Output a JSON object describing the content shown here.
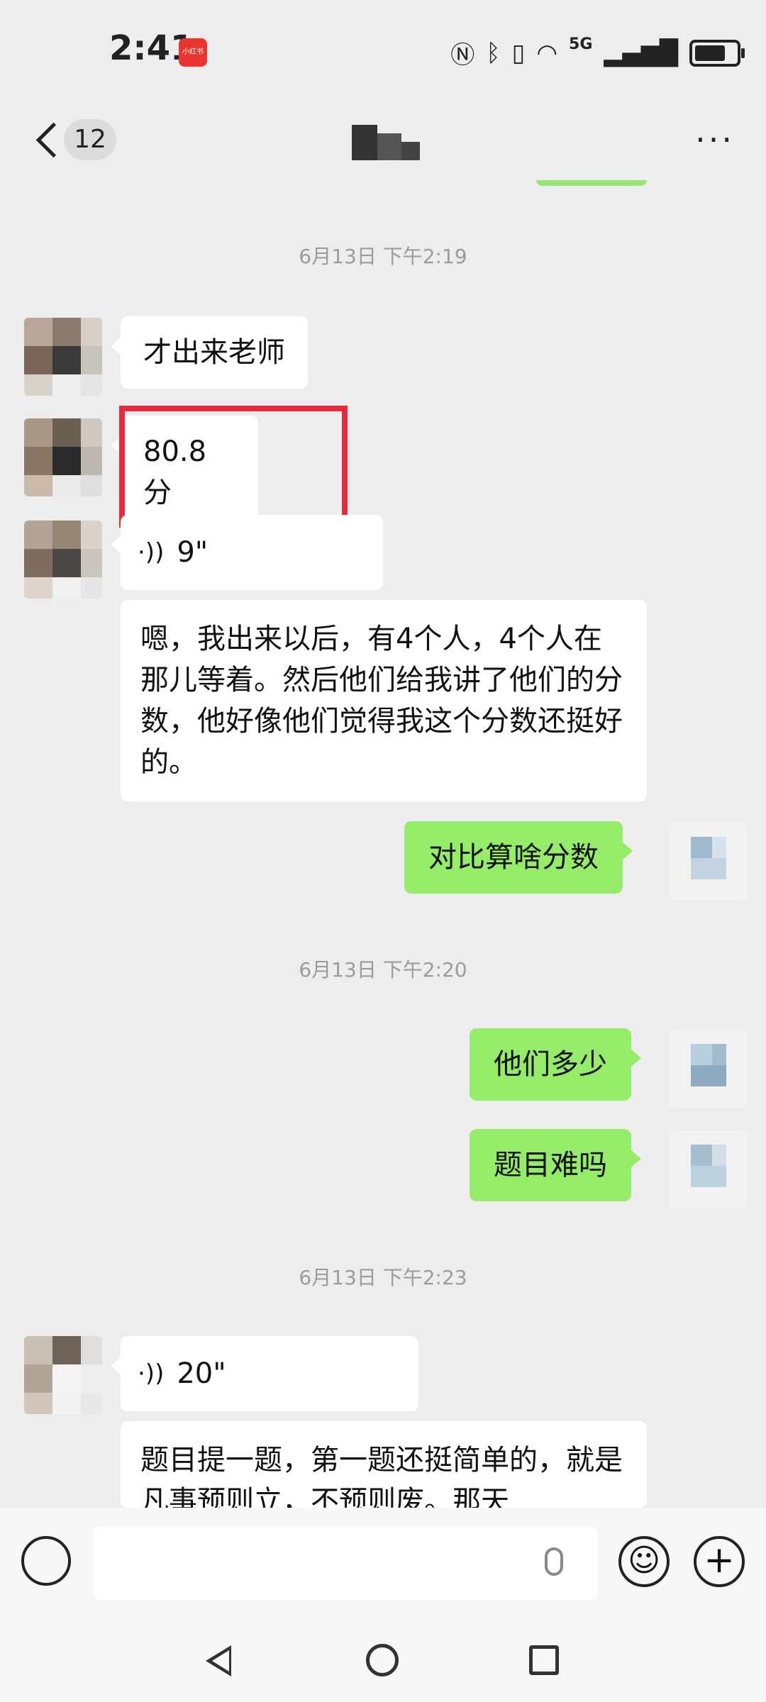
{
  "status_bar": {
    "time": "2:41",
    "app_badge": "小红书",
    "network": "5G",
    "icons": [
      "nfc-icon",
      "bluetooth-icon",
      "vibrate-icon",
      "wifi-icon",
      "signal-icon",
      "battery-icon"
    ]
  },
  "nav": {
    "unread_count": "12",
    "more_label": "···"
  },
  "messages": [
    {
      "type": "timestamp",
      "text": "6月13日 下午2:19"
    },
    {
      "type": "text",
      "from": "them",
      "text": "才出来老师"
    },
    {
      "type": "text",
      "from": "them",
      "text": "80.8 分",
      "highlighted": true
    },
    {
      "type": "voice",
      "from": "them",
      "duration": "9\""
    },
    {
      "type": "text",
      "from": "them",
      "text": "嗯，我出来以后，有4个人，4个人在那儿等着。然后他们给我讲了他们的分数，他好像他们觉得我这个分数还挺好的。"
    },
    {
      "type": "text",
      "from": "me",
      "text": "对比算啥分数"
    },
    {
      "type": "timestamp",
      "text": "6月13日 下午2:20"
    },
    {
      "type": "text",
      "from": "me",
      "text": "他们多少"
    },
    {
      "type": "text",
      "from": "me",
      "text": "题目难吗"
    },
    {
      "type": "timestamp",
      "text": "6月13日 下午2:23"
    },
    {
      "type": "voice",
      "from": "them",
      "duration": "20\""
    },
    {
      "type": "text",
      "from": "them",
      "text": "题目提一题，第一题还挺简单的，就是凡事预则立，不预则废。那天"
    }
  ],
  "colors": {
    "background": "#ededed",
    "my_bubble": "#95ec69",
    "their_bubble": "#ffffff",
    "highlight_box": "#e8293b"
  }
}
